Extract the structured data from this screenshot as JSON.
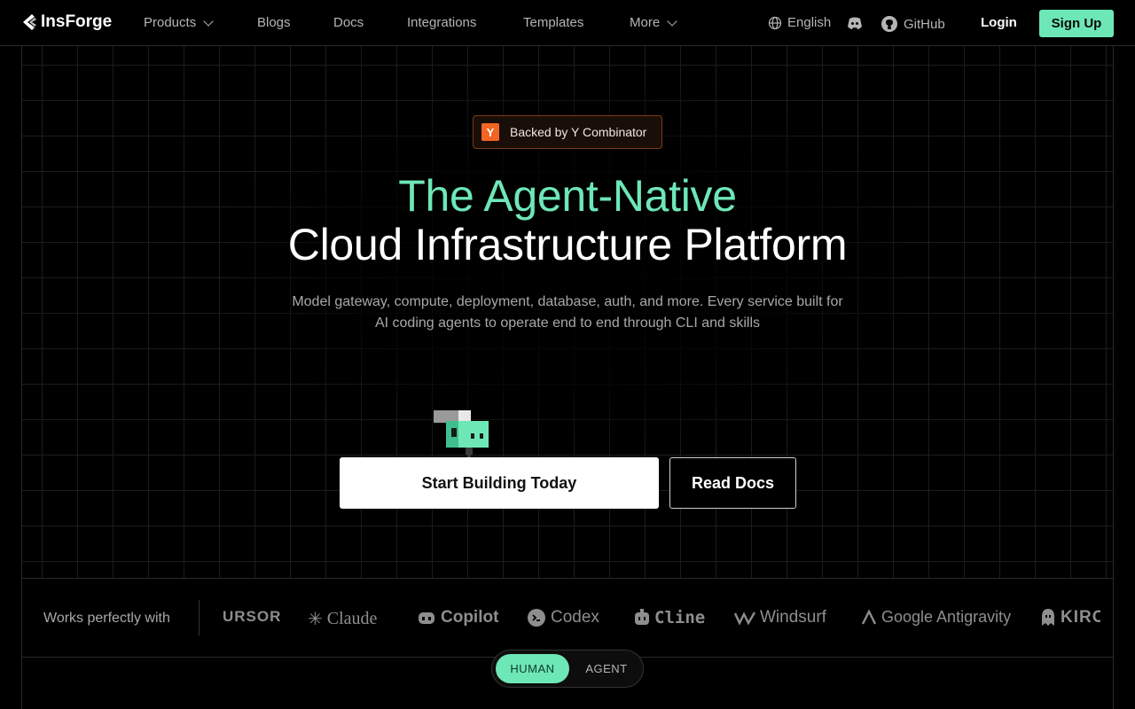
{
  "nav": {
    "logo_text": "InsForge",
    "items": [
      {
        "label": "Products",
        "has_dropdown": true
      },
      {
        "label": "Blogs"
      },
      {
        "label": "Docs"
      },
      {
        "label": "Integrations"
      },
      {
        "label": "Templates"
      },
      {
        "label": "More",
        "has_dropdown": true
      }
    ],
    "language": "English",
    "github": "GitHub",
    "login": "Login",
    "signup": "Sign Up"
  },
  "hero": {
    "badge_logo": "Y",
    "badge_text": "Backed by Y Combinator",
    "title_line1": "The Agent-Native",
    "title_line2": "Cloud Infrastructure Platform",
    "subtitle_line1": "Model gateway, compute, deployment, database, auth, and more. Every service built for",
    "subtitle_line2": "AI coding agents to operate end to end through CLI and skills",
    "primary_button": "Start Building Today",
    "secondary_button": "Read Docs"
  },
  "works_with": {
    "label": "Works perfectly with",
    "brands": [
      "URSOR",
      "Claude",
      "Copilot",
      "Codex",
      "Cline",
      "Windsurf",
      "Google Antigravity",
      "KIRO"
    ]
  },
  "toggle": {
    "human": "HUMAN",
    "agent": "AGENT",
    "selected": "HUMAN"
  },
  "colors": {
    "accent": "#6ee7b7",
    "background": "#000000",
    "yc_orange": "#f26522"
  }
}
